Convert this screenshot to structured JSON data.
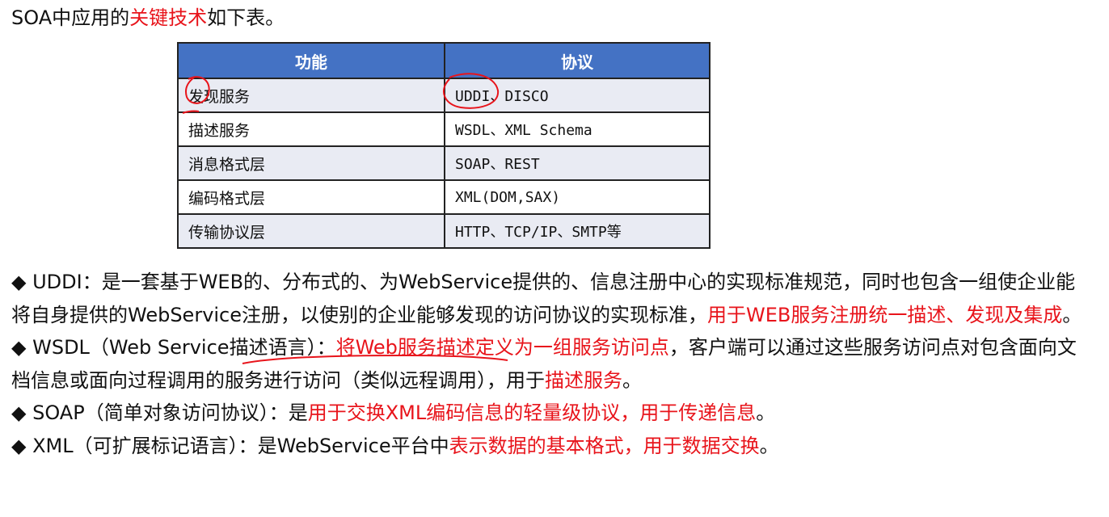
{
  "title": {
    "prefix": "SOA中应用的",
    "highlight": "关键技术",
    "suffix": "如下表。"
  },
  "table": {
    "headers": [
      "功能",
      "协议"
    ],
    "rows": [
      [
        "发现服务",
        "UDDI、DISCO"
      ],
      [
        "描述服务",
        "WSDL、XML Schema"
      ],
      [
        "消息格式层",
        "SOAP、REST"
      ],
      [
        "编码格式层",
        "XML(DOM,SAX)"
      ],
      [
        "传输协议层",
        "HTTP、TCP/IP、SMTP等"
      ]
    ]
  },
  "paragraphs": [
    {
      "bullet": "◆",
      "segments": [
        {
          "text": " UDDI：是一套基于WEB的、分布式的、为WebService提供的、信息注册中心的实现标准规范，同时也包含一组使企业能将自身提供的WebService注册，以使别的企业能够发现的访问协议的实现标准，",
          "red": false
        },
        {
          "text": "用于WEB服务注册统一描述、发现及集成",
          "red": true
        },
        {
          "text": "。",
          "red": false
        }
      ]
    },
    {
      "bullet": "◆",
      "segments": [
        {
          "text": " WSDL（Web Service描述语言）：",
          "red": false
        },
        {
          "text": "将Web服务描述定义为一组服务访问点",
          "red": true
        },
        {
          "text": "，客户端可以通过这些服务访问点对包含面向文档信息或面向过程调用的服务进行访问（类似远程调用），用于",
          "red": false
        },
        {
          "text": "描述服务",
          "red": true
        },
        {
          "text": "。",
          "red": false
        }
      ]
    },
    {
      "bullet": "◆",
      "segments": [
        {
          "text": " SOAP（简单对象访问协议）：是",
          "red": false
        },
        {
          "text": "用于交换XML编码信息的轻量级协议，用于传递信息",
          "red": true
        },
        {
          "text": "。",
          "red": false
        }
      ]
    },
    {
      "bullet": "◆",
      "segments": [
        {
          "text": " XML（可扩展标记语言）：是WebService平台中",
          "red": false
        },
        {
          "text": "表示数据的基本格式，用于数据交换",
          "red": true
        },
        {
          "text": "。",
          "red": false
        }
      ]
    }
  ],
  "colors": {
    "accent_red": "#e8141b",
    "header_blue": "#4472c4",
    "row_shade": "#e9ebf3"
  }
}
